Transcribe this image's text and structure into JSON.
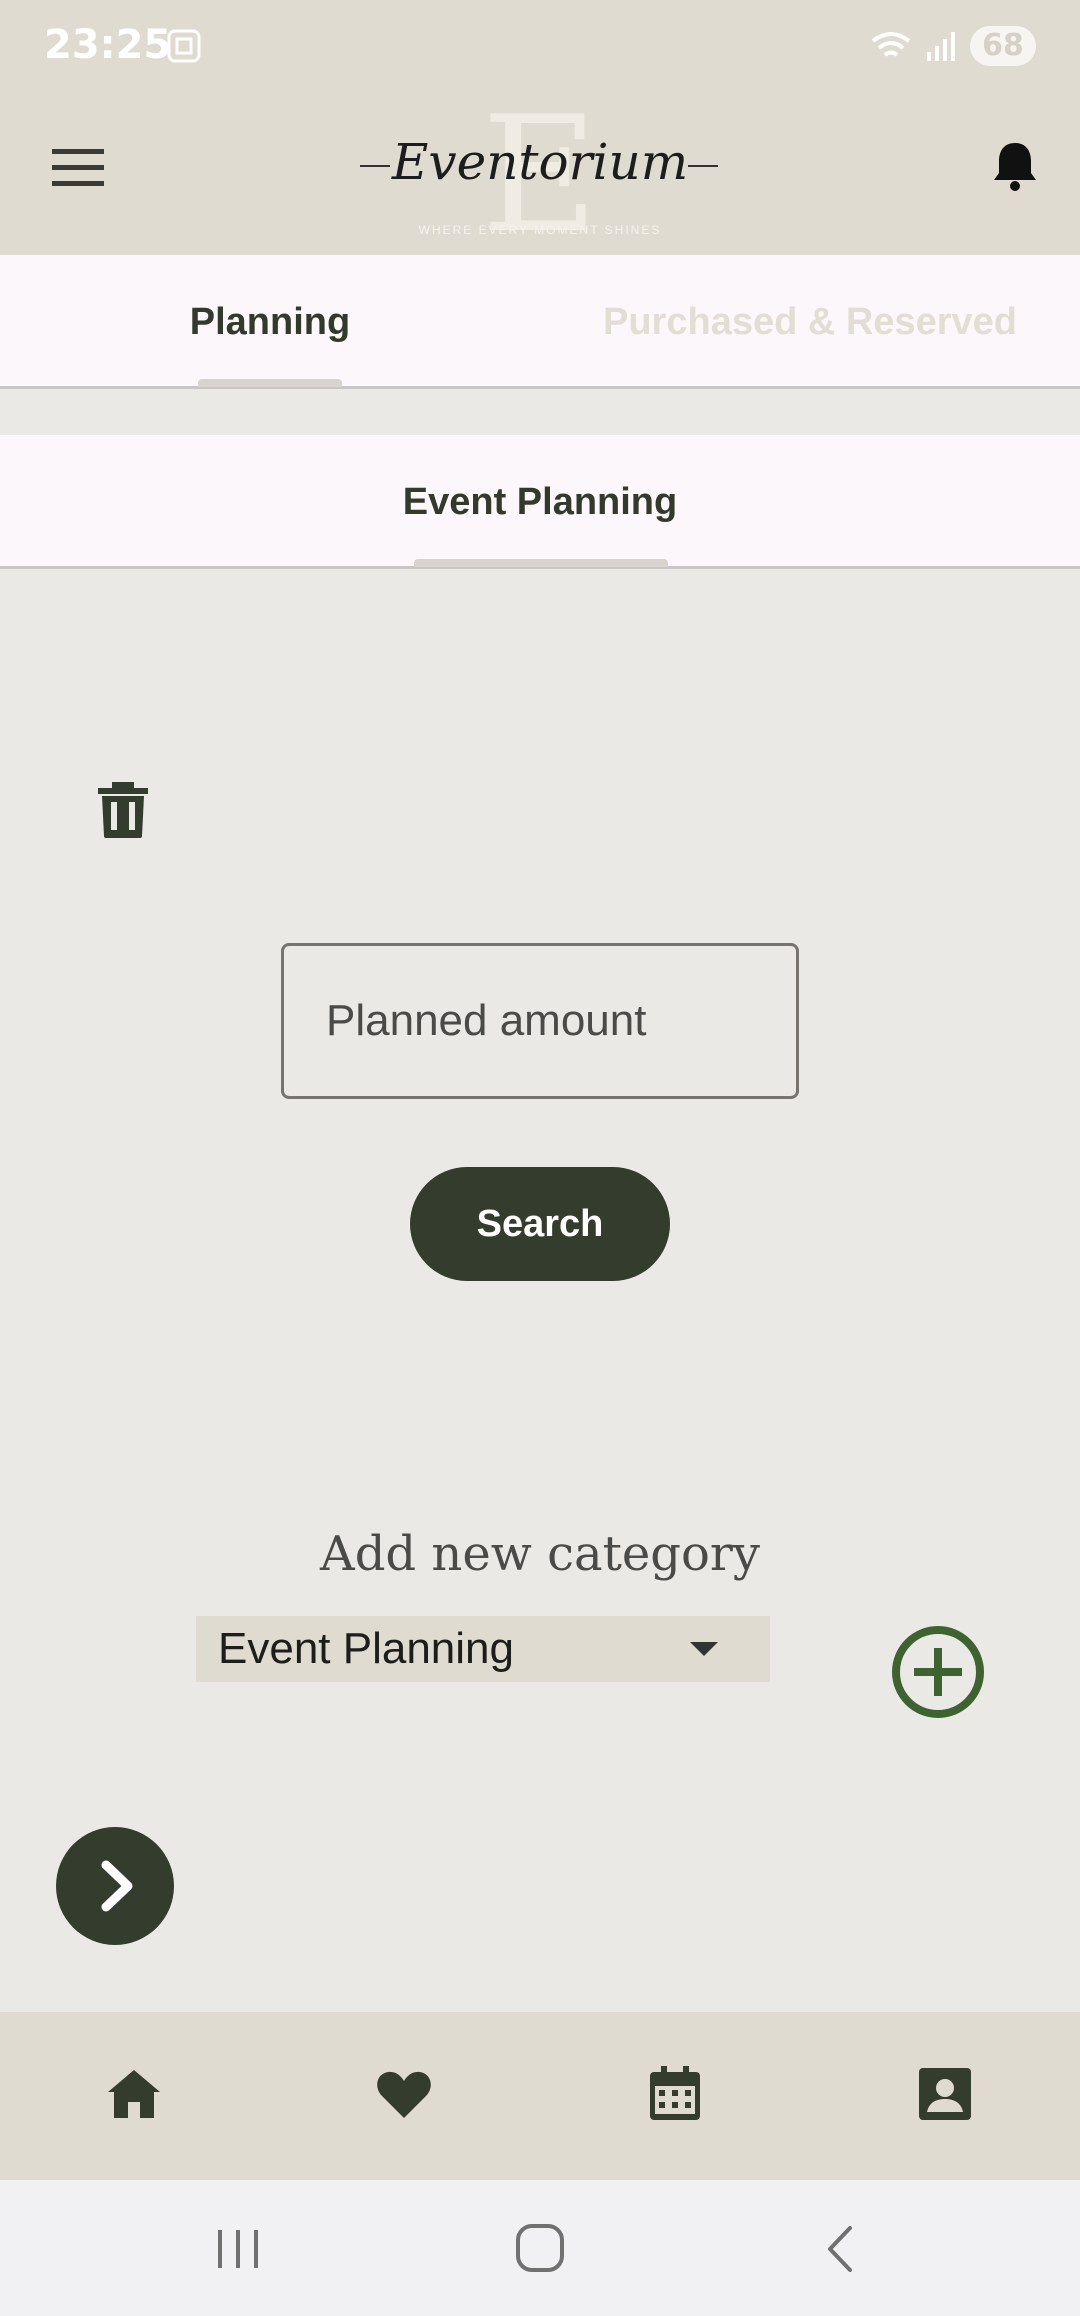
{
  "status_bar": {
    "time": "23:25",
    "battery": "68",
    "icons": [
      "screenshot-icon",
      "wifi-icon",
      "signal-icon",
      "battery-icon"
    ]
  },
  "app_bar": {
    "logo_text": "Eventorium",
    "logo_letter": "E",
    "tagline": "WHERE EVERY MOMENT SHINES",
    "icons": [
      "hamburger-menu-icon",
      "bell-icon"
    ]
  },
  "tabs": [
    {
      "label": "Planning",
      "selected": true
    },
    {
      "label": "Purchased & Reserved",
      "selected": false
    }
  ],
  "subtabs": [
    {
      "label": "Event Planning",
      "selected": true
    }
  ],
  "form": {
    "amount_placeholder": "Planned amount",
    "amount_value": "",
    "search_label": "Search"
  },
  "add_category": {
    "title": "Add new category",
    "selected_option": "Event Planning"
  },
  "bottom_nav": [
    "home-icon",
    "heart-icon",
    "calendar-icon",
    "contact-card-icon"
  ],
  "system_nav": [
    "recents-icon",
    "home-circle-icon",
    "back-icon"
  ],
  "colors": {
    "primary": "#333c2d",
    "bar_background": "#e0dbd0",
    "page_background": "#eae9e5",
    "tab_background": "#fcf7fb",
    "add_icon": "#3f6231"
  }
}
